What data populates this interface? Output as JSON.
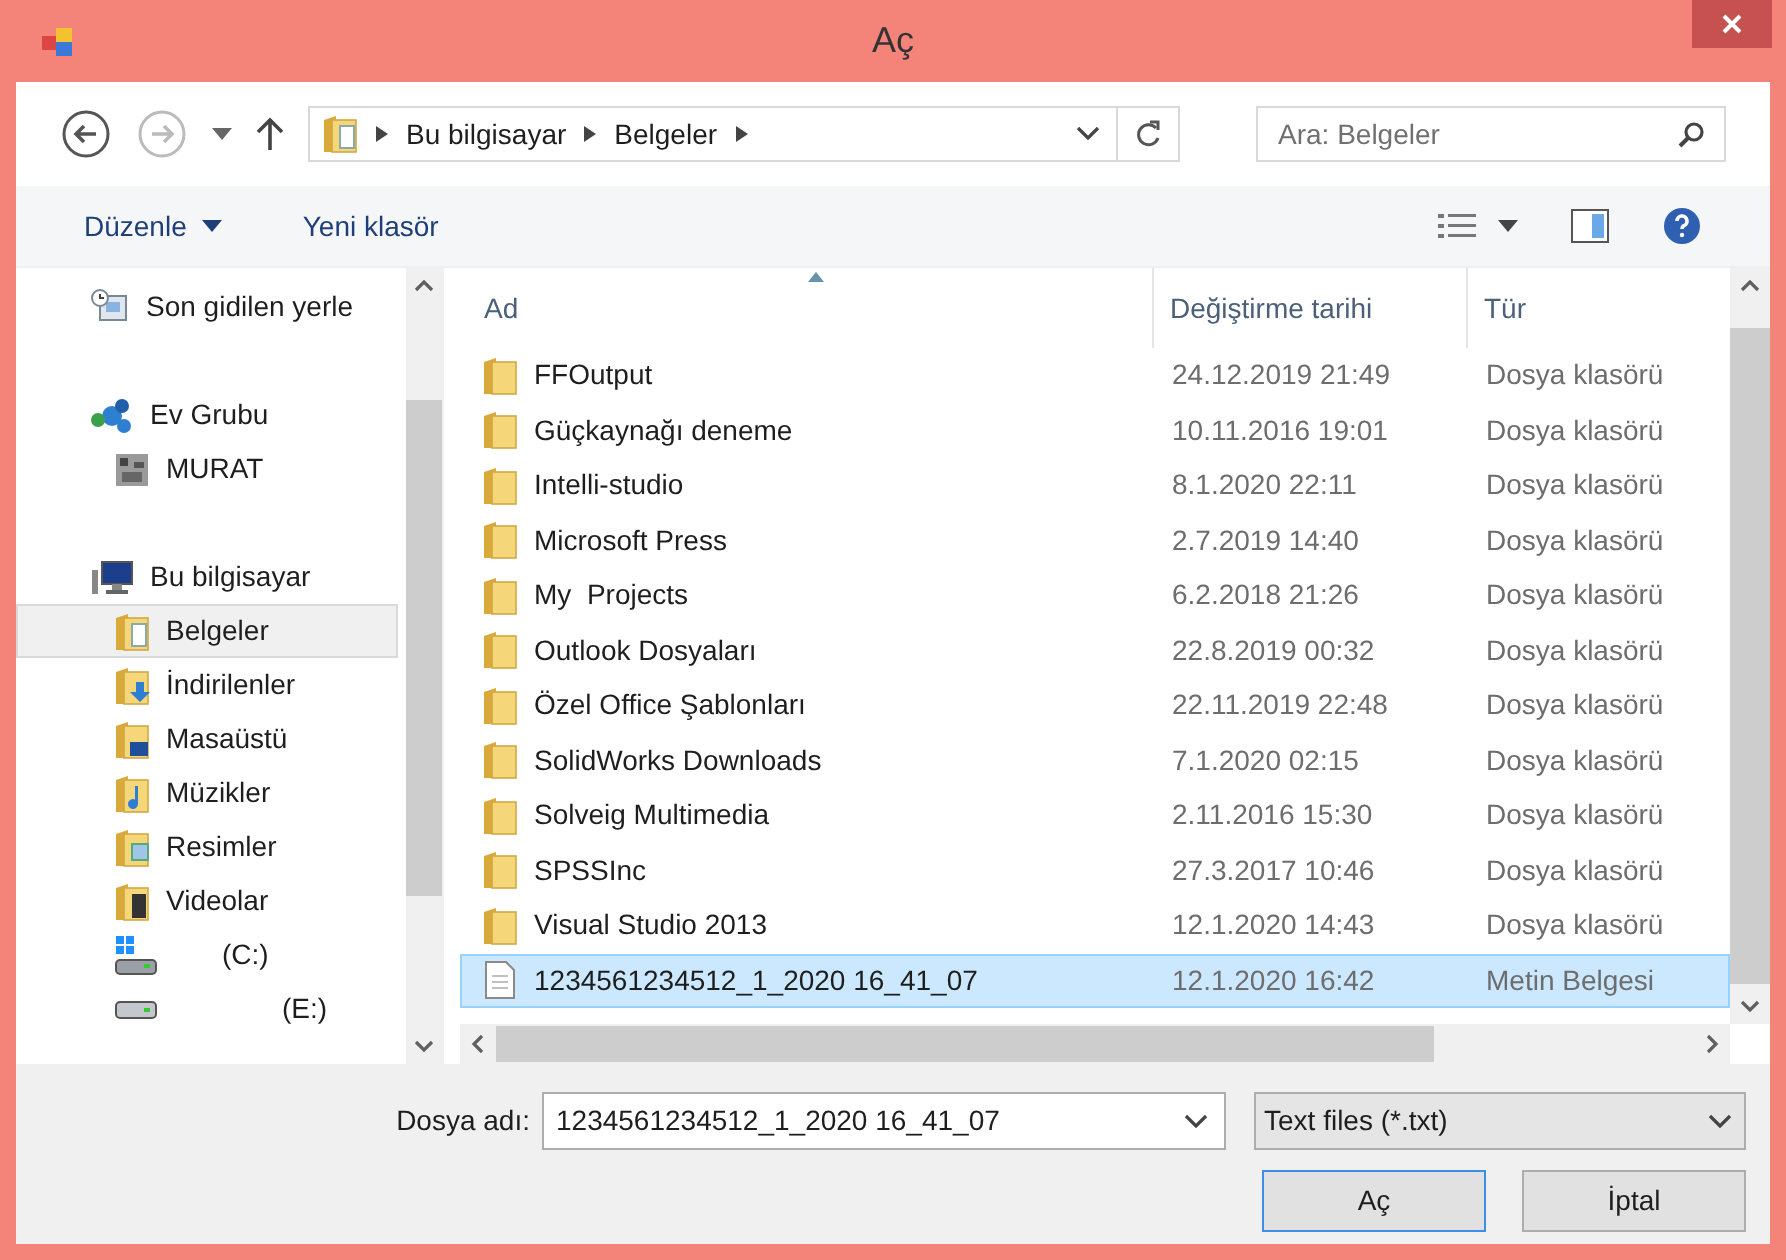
{
  "window": {
    "title": "Aç"
  },
  "address": {
    "crumbs": [
      "Bu bilgisayar",
      "Belgeler"
    ],
    "search_placeholder": "Ara: Belgeler"
  },
  "toolbar": {
    "organize": "Düzenle",
    "new_folder": "Yeni klasör"
  },
  "sidebar": {
    "groups": [
      {
        "children": [
          {
            "label": "Son gidilen yerle",
            "kind": "recent",
            "selected": false
          }
        ]
      },
      {
        "label": "Ev Grubu",
        "kind": "homegroup",
        "selected": false,
        "children": [
          {
            "label": "MURAT",
            "kind": "user",
            "selected": false
          }
        ]
      },
      {
        "label": "Bu bilgisayar",
        "kind": "pc",
        "selected": false,
        "children": [
          {
            "label": "Belgeler",
            "kind": "documents",
            "selected": true
          },
          {
            "label": "İndirilenler",
            "kind": "downloads",
            "selected": false
          },
          {
            "label": "Masaüstü",
            "kind": "desktop",
            "selected": false
          },
          {
            "label": "Müzikler",
            "kind": "music",
            "selected": false
          },
          {
            "label": "Resimler",
            "kind": "pictures",
            "selected": false
          },
          {
            "label": "Videolar",
            "kind": "videos",
            "selected": false
          },
          {
            "label": "(C:)",
            "kind": "windrive",
            "selected": false
          },
          {
            "label": "(E:)",
            "kind": "drive",
            "selected": false
          }
        ]
      }
    ]
  },
  "table": {
    "columns": [
      "Ad",
      "Değiştirme tarihi",
      "Tür"
    ],
    "rows": [
      {
        "name": "FFOutput",
        "date": "24.12.2019 21:49",
        "type": "Dosya klasörü",
        "kind": "folder",
        "selected": false
      },
      {
        "name": "Güçkaynağı deneme",
        "date": "10.11.2016 19:01",
        "type": "Dosya klasörü",
        "kind": "folder",
        "selected": false
      },
      {
        "name": "Intelli-studio",
        "date": "8.1.2020 22:11",
        "type": "Dosya klasörü",
        "kind": "folder",
        "selected": false
      },
      {
        "name": "Microsoft Press",
        "date": "2.7.2019 14:40",
        "type": "Dosya klasörü",
        "kind": "folder",
        "selected": false
      },
      {
        "name": "My  Projects",
        "date": "6.2.2018 21:26",
        "type": "Dosya klasörü",
        "kind": "folder",
        "selected": false
      },
      {
        "name": "Outlook Dosyaları",
        "date": "22.8.2019 00:32",
        "type": "Dosya klasörü",
        "kind": "folder",
        "selected": false
      },
      {
        "name": "Özel Office Şablonları",
        "date": "22.11.2019 22:48",
        "type": "Dosya klasörü",
        "kind": "folder",
        "selected": false
      },
      {
        "name": "SolidWorks Downloads",
        "date": "7.1.2020 02:15",
        "type": "Dosya klasörü",
        "kind": "folder",
        "selected": false
      },
      {
        "name": "Solveig Multimedia",
        "date": "2.11.2016 15:30",
        "type": "Dosya klasörü",
        "kind": "folder",
        "selected": false
      },
      {
        "name": "SPSSInc",
        "date": "27.3.2017 10:46",
        "type": "Dosya klasörü",
        "kind": "folder",
        "selected": false
      },
      {
        "name": "Visual Studio 2013",
        "date": "12.1.2020 14:43",
        "type": "Dosya klasörü",
        "kind": "folder",
        "selected": false
      },
      {
        "name": "1234561234512_1_2020 16_41_07",
        "date": "12.1.2020 16:42",
        "type": "Metin Belgesi",
        "kind": "text",
        "selected": true
      }
    ]
  },
  "footer": {
    "filename_label": "Dosya adı:",
    "filename": "1234561234512_1_2020 16_41_07",
    "filter": "Text files (*.txt)",
    "buttons": [
      "Aç",
      "İptal"
    ]
  }
}
